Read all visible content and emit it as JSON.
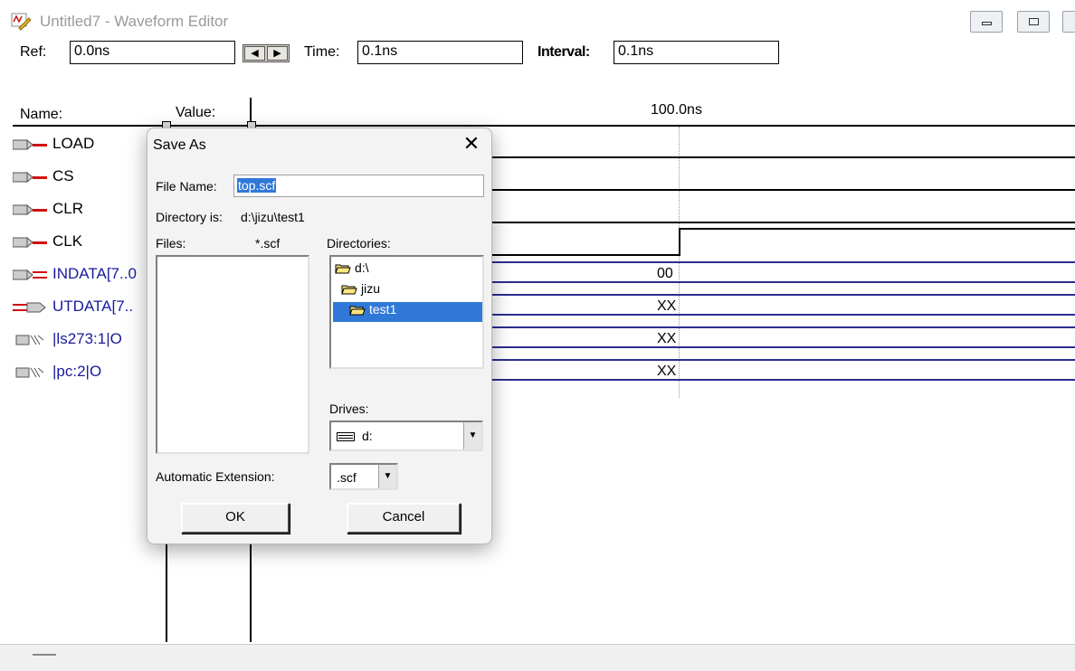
{
  "window": {
    "title": "Untitled7 - Waveform Editor"
  },
  "toolbar": {
    "ref_label": "Ref:",
    "ref_value": "0.0ns",
    "time_label": "Time:",
    "time_value": "0.1ns",
    "interval_label": "Interval:",
    "interval_value": "0.1ns"
  },
  "header": {
    "name_label": "Name:",
    "value_label": "Value:",
    "time_marker": "100.0ns"
  },
  "signals": [
    {
      "name": "LOAD",
      "type": "input"
    },
    {
      "name": "CS",
      "type": "input"
    },
    {
      "name": "CLR",
      "type": "input"
    },
    {
      "name": "CLK",
      "type": "input"
    },
    {
      "name": "INDATA[7..0",
      "type": "input-bus",
      "value": "00"
    },
    {
      "name": "UTDATA[7..",
      "type": "output-bus",
      "value": "XX"
    },
    {
      "name": "|ls273:1|O",
      "type": "buried",
      "value": "XX"
    },
    {
      "name": "|pc:2|O",
      "type": "buried",
      "value": "XX"
    }
  ],
  "dialog": {
    "title": "Save As",
    "close": "✕",
    "file_name_label": "File Name:",
    "file_name_value": "top.scf",
    "directory_label": "Directory is:",
    "directory_value": "d:\\jizu\\test1",
    "files_label": "Files:",
    "files_filter": "*.scf",
    "directories_label": "Directories:",
    "directories": [
      "d:\\",
      "jizu",
      "test1"
    ],
    "selected_directory": "test1",
    "drives_label": "Drives:",
    "drive_value": "d:",
    "auto_ext_label": "Automatic Extension:",
    "auto_ext_value": ".scf",
    "ok_label": "OK",
    "cancel_label": "Cancel"
  },
  "colors": {
    "selection": "#3078d8",
    "bus_line": "#2c2c90",
    "signal_name_blue": "#1a1a9a",
    "input_arrow_red": "#d01010"
  }
}
